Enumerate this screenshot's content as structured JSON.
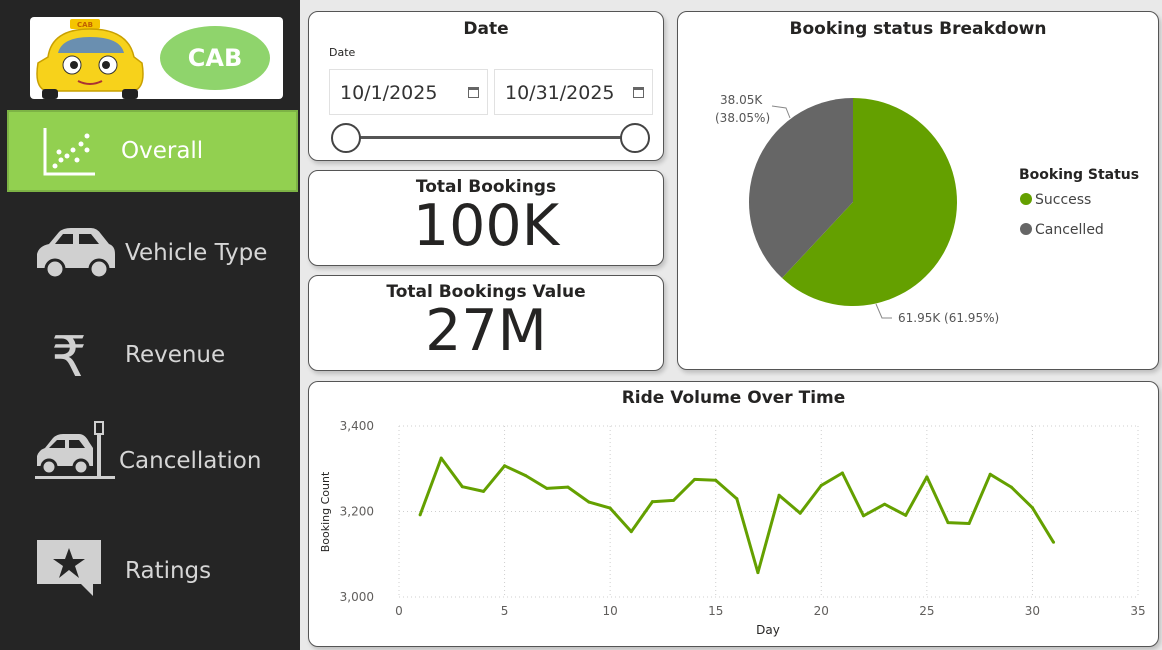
{
  "logo": {
    "text": "CAB",
    "badge": "CAB"
  },
  "nav": [
    {
      "label": "Overall",
      "icon": "scatter-chart-icon",
      "active": true
    },
    {
      "label": "Vehicle Type",
      "icon": "car-icon",
      "active": false
    },
    {
      "label": "Revenue",
      "icon": "rupee-icon",
      "active": false
    },
    {
      "label": "Cancellation",
      "icon": "car-crash-icon",
      "active": false
    },
    {
      "label": "Ratings",
      "icon": "star-comment-icon",
      "active": false
    }
  ],
  "date_filter": {
    "title": "Date",
    "label": "Date",
    "start": "10/1/2025",
    "end": "10/31/2025",
    "range_fraction": [
      0.0,
      1.0
    ]
  },
  "kpis": [
    {
      "title": "Total Bookings",
      "value": "100K"
    },
    {
      "title": "Total Bookings Value",
      "value": "27M"
    }
  ],
  "colors": {
    "accent": "#92d050",
    "success": "#64a000",
    "cancelled": "#666666",
    "sidebar": "#252525"
  },
  "chart_data": [
    {
      "type": "pie",
      "title": "Booking status Breakdown",
      "legend_title": "Booking Status",
      "legend_position": "right",
      "slices": [
        {
          "name": "Success",
          "value": 61.95,
          "label": "61.95K (61.95%)",
          "color": "#64a000"
        },
        {
          "name": "Cancelled",
          "value": 38.05,
          "label": "38.05K",
          "sublabel": "(38.05%)",
          "color": "#666666"
        }
      ]
    },
    {
      "type": "line",
      "title": "Ride Volume Over Time",
      "xlabel": "Day",
      "ylabel": "Booking Count",
      "xlim": [
        0,
        35
      ],
      "ylim": [
        3000,
        3400
      ],
      "x_ticks": [
        "0",
        "5",
        "10",
        "15",
        "20",
        "25",
        "30",
        "35"
      ],
      "y_ticks": [
        "3,000",
        "3,200",
        "3,400"
      ],
      "grid": true,
      "series": [
        {
          "color": "#64a000",
          "x": [
            1,
            2,
            3,
            4,
            5,
            6,
            7,
            8,
            9,
            10,
            11,
            12,
            13,
            14,
            15,
            16,
            17,
            18,
            19,
            20,
            21,
            22,
            23,
            24,
            25,
            26,
            27,
            28,
            29,
            30,
            31
          ],
          "y": [
            3192,
            3325,
            3258,
            3247,
            3307,
            3284,
            3254,
            3257,
            3222,
            3208,
            3153,
            3223,
            3226,
            3275,
            3273,
            3230,
            3057,
            3238,
            3196,
            3261,
            3290,
            3190,
            3217,
            3191,
            3281,
            3174,
            3172,
            3287,
            3257,
            3209,
            3128
          ]
        }
      ]
    }
  ]
}
